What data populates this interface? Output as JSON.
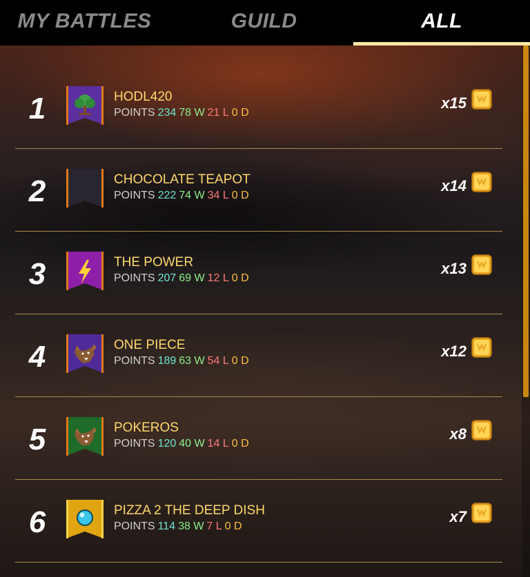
{
  "tabs": [
    {
      "label": "MY BATTLES",
      "active": false
    },
    {
      "label": "GUILD",
      "active": false
    },
    {
      "label": "ALL",
      "active": true
    }
  ],
  "colors": {
    "accent": "#ffe7a3",
    "name": "#ffd96b",
    "points": "#6ee7d2",
    "wins": "#8cf08c",
    "losses": "#ff7a7a",
    "draws": "#ffbf3f",
    "scroll_thumb": "#c9870f"
  },
  "leaderboard": [
    {
      "rank": "1",
      "name": "HODL420",
      "points_label": "POINTS",
      "points": "234",
      "wins": "78 W",
      "losses": "21 L",
      "draws": "0 D",
      "multiplier": "x15",
      "banner_icon": "tree-icon",
      "banner_color": "#5b2fa0"
    },
    {
      "rank": "2",
      "name": "CHOCOLATE TEAPOT",
      "points_label": "POINTS",
      "points": "222",
      "wins": "74 W",
      "losses": "34 L",
      "draws": "0 D",
      "multiplier": "x14",
      "banner_icon": "blank-banner-icon",
      "banner_color": "#2a2630"
    },
    {
      "rank": "3",
      "name": "THE POWER",
      "points_label": "POINTS",
      "points": "207",
      "wins": "69 W",
      "losses": "12 L",
      "draws": "0 D",
      "multiplier": "x13",
      "banner_icon": "lightning-icon",
      "banner_color": "#8e1fa8"
    },
    {
      "rank": "4",
      "name": "ONE PIECE",
      "points_label": "POINTS",
      "points": "189",
      "wins": "63 W",
      "losses": "54 L",
      "draws": "0 D",
      "multiplier": "x12",
      "banner_icon": "wolf-icon",
      "banner_color": "#4f2b9a"
    },
    {
      "rank": "5",
      "name": "POKEROS",
      "points_label": "POINTS",
      "points": "120",
      "wins": "40 W",
      "losses": "14 L",
      "draws": "0 D",
      "multiplier": "x8",
      "banner_icon": "wolf-icon",
      "banner_color": "#1f6b2a"
    },
    {
      "rank": "6",
      "name": "PIZZA 2 THE DEEP DISH",
      "points_label": "POINTS",
      "points": "114",
      "wins": "38 W",
      "losses": "7 L",
      "draws": "0 D",
      "multiplier": "x7",
      "banner_icon": "orb-icon",
      "banner_color": "#e0a510"
    }
  ]
}
